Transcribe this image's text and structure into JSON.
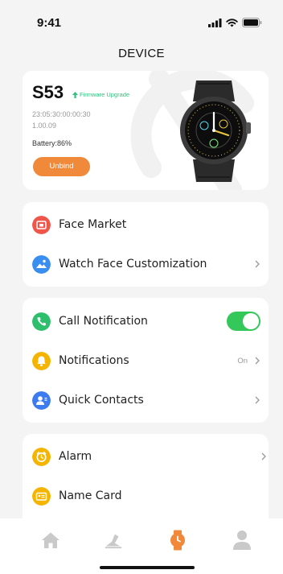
{
  "status_bar": {
    "time": "9:41"
  },
  "header": {
    "title": "DEVICE"
  },
  "device": {
    "model": "S53",
    "firmware_upgrade_label": "Firmware Upgrade",
    "mac": "23:05:30:00:00:30",
    "version": "1.00.09",
    "battery": "Battery:86%",
    "unbind_label": "Unbind"
  },
  "group1": {
    "items": [
      {
        "label": "Face Market"
      },
      {
        "label": "Watch Face Customization"
      }
    ]
  },
  "group2": {
    "items": [
      {
        "label": "Call Notification",
        "toggle_on": true
      },
      {
        "label": "Notifications",
        "value": "On"
      },
      {
        "label": "Quick Contacts"
      }
    ]
  },
  "group3": {
    "items": [
      {
        "label": "Alarm"
      },
      {
        "label": "Name Card"
      }
    ]
  },
  "tab_bar": {
    "tabs": [
      "home-icon",
      "workout-icon",
      "watch-icon",
      "profile-icon"
    ],
    "active_index": 2
  },
  "colors": {
    "accent_orange": "#f0893a",
    "toggle_green": "#34c759",
    "firmware_green": "#2ec27e",
    "face_market_red": "#f0554a",
    "customize_blue": "#3a8ef0",
    "call_green": "#2ebf6c",
    "notif_yellow": "#f5b400",
    "contacts_blue": "#3c7cf0",
    "alarm_yellow": "#f5b400"
  }
}
